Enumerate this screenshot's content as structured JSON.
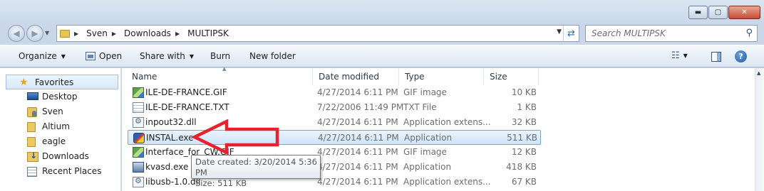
{
  "window": {
    "buttons": {
      "minimize": "▬",
      "maximize": "▢",
      "close": "✕"
    }
  },
  "address_bar": {
    "crumbs": [
      "Sven",
      "Downloads",
      "MULTIPSK"
    ],
    "search_placeholder": "Search MULTIPSK"
  },
  "toolbar": {
    "organize": "Organize",
    "open": "Open",
    "share_with": "Share with",
    "burn": "Burn",
    "new_folder": "New folder"
  },
  "sidebar": {
    "items": [
      {
        "label": "Favorites",
        "icon": "star-icon"
      },
      {
        "label": "Desktop",
        "icon": "desktop-icon"
      },
      {
        "label": "Sven",
        "icon": "user-folder-icon"
      },
      {
        "label": "Altium",
        "icon": "folder-icon"
      },
      {
        "label": "eagle",
        "icon": "folder-icon"
      },
      {
        "label": "Downloads",
        "icon": "downloads-icon"
      },
      {
        "label": "Recent Places",
        "icon": "recent-places-icon"
      }
    ]
  },
  "file_list": {
    "columns": [
      "Name",
      "Date modified",
      "Type",
      "Size"
    ],
    "rows": [
      {
        "name": "ILE-DE-FRANCE.GIF",
        "date": "4/27/2014 6:11 PM",
        "type": "GIF image",
        "size": "10 KB",
        "icon": "gif-image-icon"
      },
      {
        "name": "ILE-DE-FRANCE.TXT",
        "date": "7/22/2006 11:49 PM",
        "type": "TXT File",
        "size": "1 KB",
        "icon": "text-file-icon"
      },
      {
        "name": "inpout32.dll",
        "date": "4/27/2014 6:11 PM",
        "type": "Application extens...",
        "size": "32 KB",
        "icon": "dll-file-icon"
      },
      {
        "name": "INSTAL.exe",
        "date": "4/27/2014 6:11 PM",
        "type": "Application",
        "size": "511 KB",
        "icon": "installer-icon"
      },
      {
        "name": "Interface_for_CW.GIF",
        "date": "4/27/2014 6:11 PM",
        "type": "GIF image",
        "size": "12 KB",
        "icon": "gif-image-icon"
      },
      {
        "name": "kvasd.exe",
        "date": "4/27/2014 6:11 PM",
        "type": "Application",
        "size": "418 KB",
        "icon": "application-icon"
      },
      {
        "name": "libusb-1.0.dll",
        "date": "4/27/2014 6:11 PM",
        "type": "Application extens...",
        "size": "67 KB",
        "icon": "dll-file-icon"
      }
    ],
    "selected_index": 3
  },
  "tooltip": {
    "line1": "Date created: 3/20/2014 5:36 PM",
    "line2": "Size: 511 KB"
  },
  "colors": {
    "annotation_arrow": "#e8212a",
    "selection_border": "#7da2ce"
  }
}
